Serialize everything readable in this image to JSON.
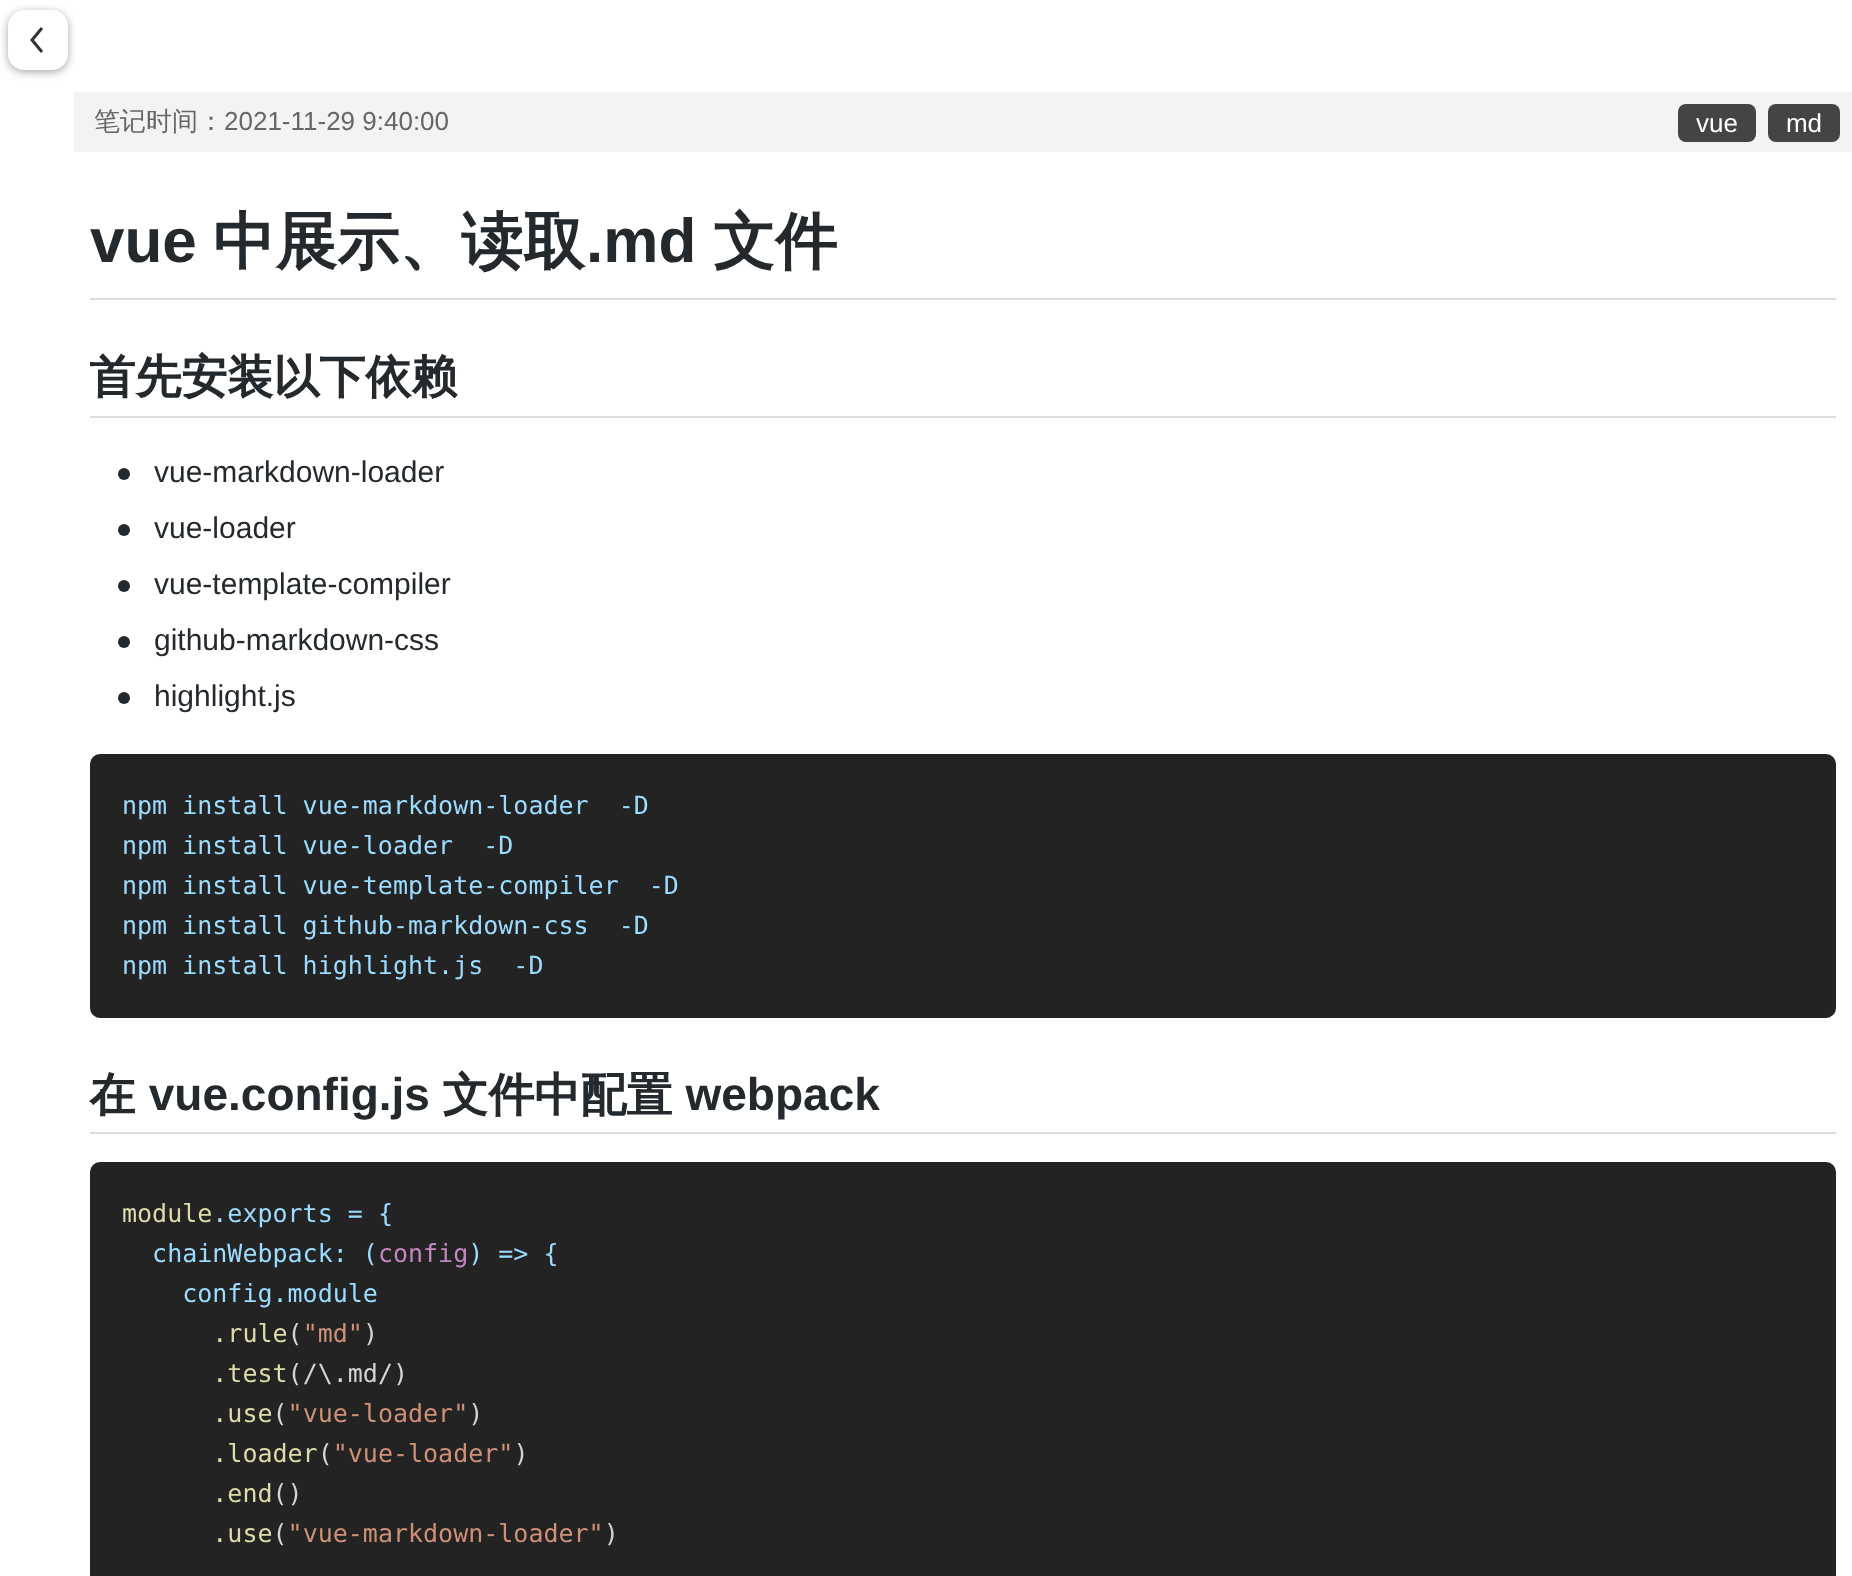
{
  "meta": {
    "label": "笔记时间：2021-11-29 9:40:00",
    "tags": [
      "vue",
      "md"
    ]
  },
  "title": "vue 中展示、读取.md 文件",
  "sections": [
    {
      "heading": "首先安装以下依赖",
      "list": [
        "vue-markdown-loader",
        "vue-loader",
        "vue-template-compiler",
        "github-markdown-css",
        "highlight.js"
      ],
      "code": [
        [
          {
            "text": "npm install vue-markdown-loader  -D",
            "kind": "name"
          }
        ],
        [
          {
            "text": "npm install vue-loader  -D",
            "kind": "name"
          }
        ],
        [
          {
            "text": "npm install vue-template-compiler  -D",
            "kind": "name"
          }
        ],
        [
          {
            "text": "npm install github-markdown-css  -D",
            "kind": "name"
          }
        ],
        [
          {
            "text": "npm install highlight.js  -D",
            "kind": "name"
          }
        ]
      ]
    },
    {
      "heading": "在 vue.config.js 文件中配置 webpack",
      "code": [
        [
          {
            "text": "module",
            "kind": "func"
          },
          {
            "text": ".exports = {",
            "kind": "name"
          }
        ],
        [
          {
            "text": "  chainWebpack: (",
            "kind": "name"
          },
          {
            "text": "config",
            "kind": "param"
          },
          {
            "text": ") => {",
            "kind": "name"
          }
        ],
        [
          {
            "text": "    config.module",
            "kind": "name"
          }
        ],
        [
          {
            "text": "      .rule",
            "kind": "func"
          },
          {
            "text": "(",
            "kind": "punct"
          },
          {
            "text": "\"md\"",
            "kind": "str"
          },
          {
            "text": ")",
            "kind": "punct"
          }
        ],
        [
          {
            "text": "      .test",
            "kind": "func"
          },
          {
            "text": "(/\\.md/)",
            "kind": "punct"
          }
        ],
        [
          {
            "text": "      .use",
            "kind": "func"
          },
          {
            "text": "(",
            "kind": "punct"
          },
          {
            "text": "\"vue-loader\"",
            "kind": "str"
          },
          {
            "text": ")",
            "kind": "punct"
          }
        ],
        [
          {
            "text": "      .loader",
            "kind": "func"
          },
          {
            "text": "(",
            "kind": "punct"
          },
          {
            "text": "\"vue-loader\"",
            "kind": "str"
          },
          {
            "text": ")",
            "kind": "punct"
          }
        ],
        [
          {
            "text": "      .end",
            "kind": "func"
          },
          {
            "text": "()",
            "kind": "punct"
          }
        ],
        [
          {
            "text": "      .use",
            "kind": "func"
          },
          {
            "text": "(",
            "kind": "punct"
          },
          {
            "text": "\"vue-markdown-loader\"",
            "kind": "str"
          },
          {
            "text": ")",
            "kind": "punct"
          }
        ]
      ]
    }
  ]
}
